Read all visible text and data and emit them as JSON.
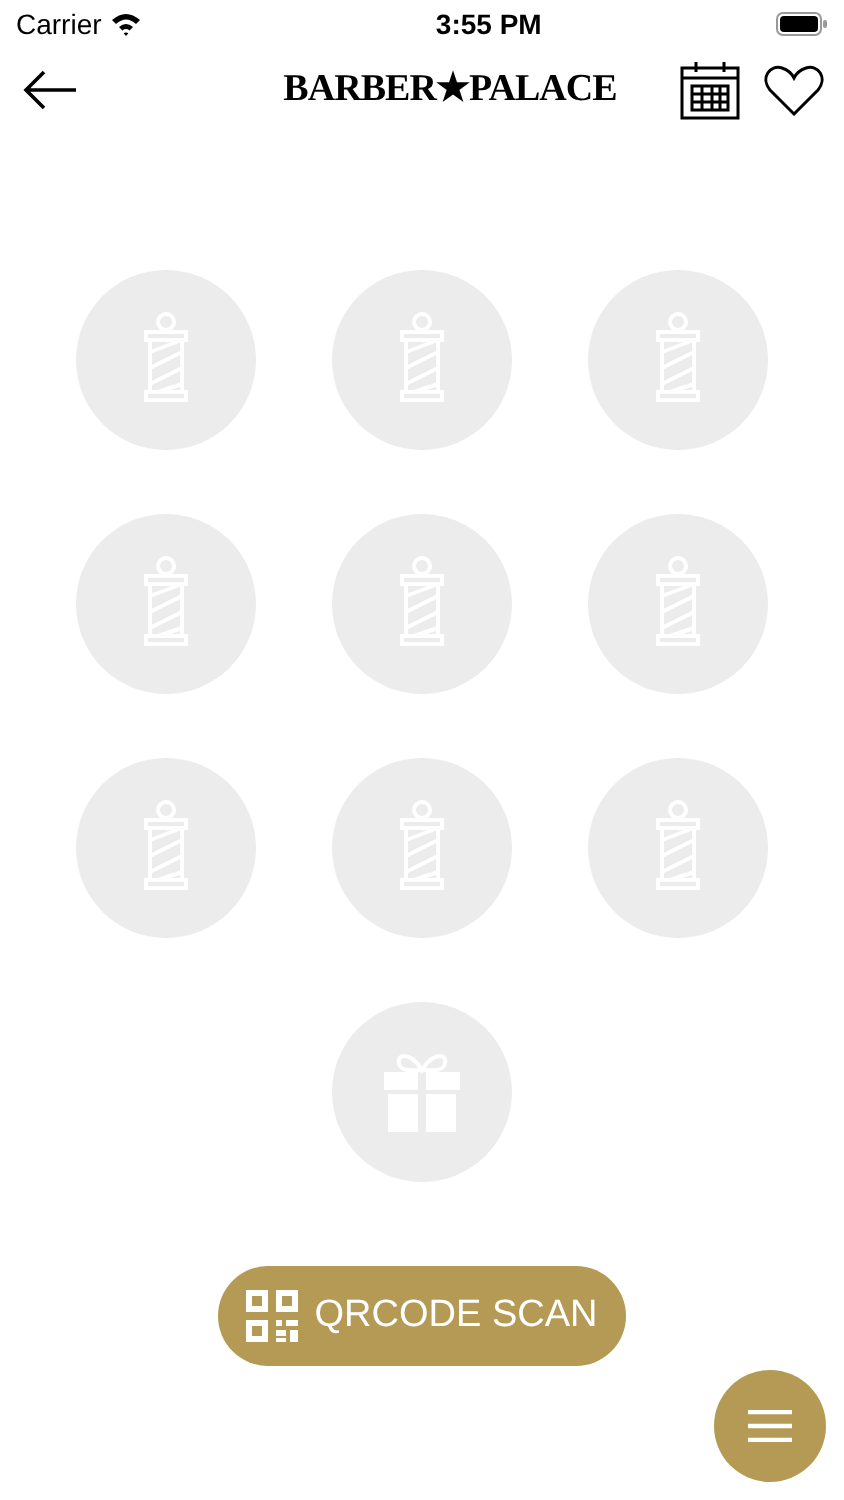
{
  "status_bar": {
    "carrier": "Carrier",
    "time": "3:55 PM"
  },
  "header": {
    "logo": "BARBER★PALACE"
  },
  "stamps": [
    {
      "kind": "pole",
      "stamped": false
    },
    {
      "kind": "pole",
      "stamped": false
    },
    {
      "kind": "pole",
      "stamped": false
    },
    {
      "kind": "pole",
      "stamped": false
    },
    {
      "kind": "pole",
      "stamped": false
    },
    {
      "kind": "pole",
      "stamped": false
    },
    {
      "kind": "pole",
      "stamped": false
    },
    {
      "kind": "pole",
      "stamped": false
    },
    {
      "kind": "pole",
      "stamped": false
    },
    {
      "kind": "gift",
      "stamped": false
    }
  ],
  "scan_button": {
    "label": "QRCODE SCAN"
  }
}
